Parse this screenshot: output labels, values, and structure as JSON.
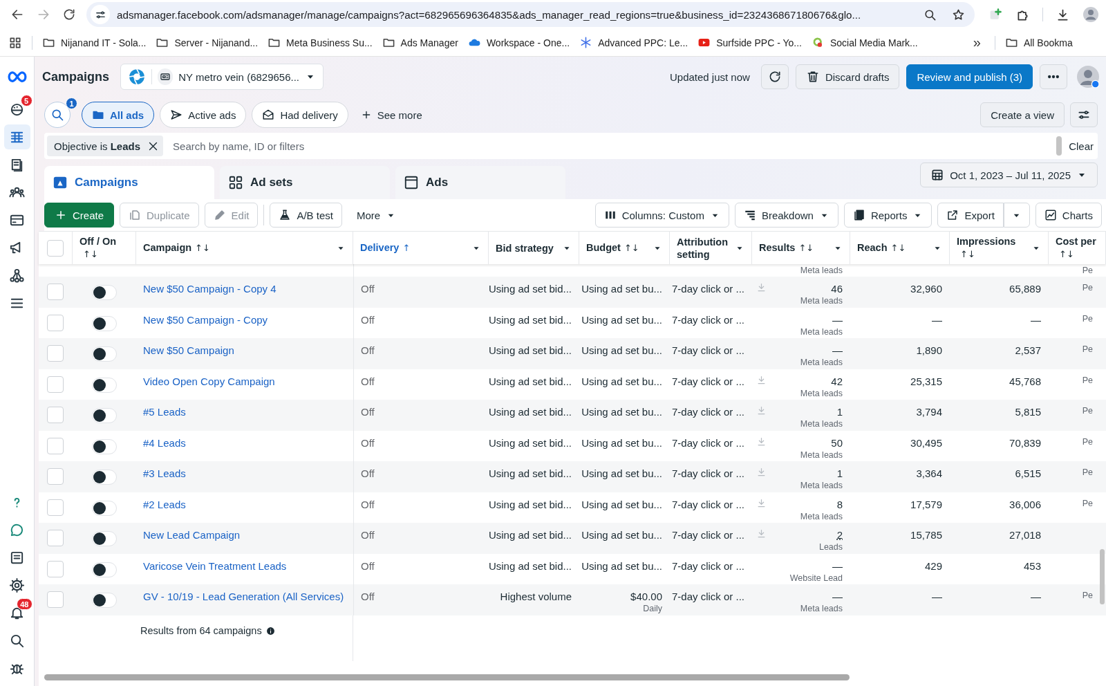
{
  "browser": {
    "url": "adsmanager.facebook.com/adsmanager/manage/campaigns?act=682965696364835&ads_manager_read_regions=true&business_id=232436867180676&glo...",
    "bookmarks": [
      {
        "kind": "folder",
        "label": "Nijanand IT - Sola..."
      },
      {
        "kind": "folder",
        "label": "Server - Nijanand..."
      },
      {
        "kind": "folder",
        "label": "Meta Business Su..."
      },
      {
        "kind": "folder",
        "label": "Ads Manager"
      },
      {
        "kind": "cloud",
        "label": "Workspace - One..."
      },
      {
        "kind": "asterisk",
        "label": "Advanced PPC: Le..."
      },
      {
        "kind": "play",
        "label": "Surfside PPC - Yo..."
      },
      {
        "kind": "gear",
        "label": "Social Media Mark..."
      }
    ],
    "overflow": "»",
    "all_bookmarks": "All Bookma"
  },
  "rail": {
    "top": [
      {
        "kind": "gauge",
        "selected": false,
        "badge": "5"
      },
      {
        "kind": "table",
        "selected": true
      },
      {
        "kind": "pages",
        "selected": false
      },
      {
        "kind": "people",
        "selected": false
      },
      {
        "kind": "card",
        "selected": false
      },
      {
        "kind": "megaphone",
        "selected": false
      },
      {
        "kind": "network",
        "selected": false
      },
      {
        "kind": "menu",
        "selected": false
      }
    ],
    "bottom": [
      {
        "kind": "question",
        "selected": false
      },
      {
        "kind": "chat",
        "selected": false
      },
      {
        "kind": "document",
        "selected": false
      },
      {
        "kind": "gear",
        "selected": false
      },
      {
        "kind": "bell",
        "selected": false,
        "badge": "48"
      },
      {
        "kind": "search",
        "selected": false
      },
      {
        "kind": "bug",
        "selected": false
      }
    ]
  },
  "header": {
    "title": "Campaigns",
    "account": "NY metro vein (6829656...",
    "updated": "Updated just now",
    "discard": "Discard drafts",
    "publish": "Review and publish (3)"
  },
  "filters": {
    "search_badge": "1",
    "chips": [
      {
        "kind": "folder",
        "label": "All ads",
        "selected": true
      },
      {
        "kind": "send",
        "label": "Active ads",
        "selected": false
      },
      {
        "kind": "envelope",
        "label": "Had delivery",
        "selected": false
      }
    ],
    "see_more": "See more",
    "create_view": "Create a view"
  },
  "search": {
    "tag": "Objective is **Leads**",
    "placeholder": "Search by name, ID or filters",
    "clear": "Clear"
  },
  "tabs": [
    {
      "kind": "campaigns",
      "label": "Campaigns",
      "selected": true
    },
    {
      "kind": "adsets",
      "label": "Ad sets",
      "selected": false
    },
    {
      "kind": "ads",
      "label": "Ads",
      "selected": false
    }
  ],
  "date_range": "Oct 1, 2023 – Jul 11, 2025",
  "toolbar": {
    "left": [
      {
        "kind": "create",
        "label": "Create",
        "disabled": false
      },
      {
        "kind": "duplicate",
        "label": "Duplicate",
        "disabled": true
      },
      {
        "kind": "edit",
        "label": "Edit",
        "disabled": true
      },
      {
        "kind": "abtest",
        "label": "A/B test",
        "disabled": false
      },
      {
        "kind": "more",
        "label": "More",
        "disabled": false
      }
    ],
    "right": [
      {
        "kind": "columns",
        "label": "Columns: Custom"
      },
      {
        "kind": "breakdown",
        "label": "Breakdown"
      },
      {
        "kind": "reports",
        "label": "Reports"
      },
      {
        "kind": "export",
        "label": "Export"
      },
      {
        "kind": "charts",
        "label": "Charts"
      }
    ]
  },
  "table": {
    "columns": [
      {
        "kind": "check",
        "checked": false
      },
      {
        "kind": "text",
        "label": "Off / On",
        "sort": "↑↓",
        "sorted": false
      },
      {
        "kind": "menu",
        "label": "Campaign",
        "sort": "↑↓",
        "sorted": false
      },
      {
        "kind": "menu",
        "label": "Delivery",
        "sort": "↑",
        "sorted": true
      },
      {
        "kind": "menu",
        "label": "Bid strategy",
        "sorted": false
      },
      {
        "kind": "menu",
        "label": "Budget",
        "sort": "↑↓",
        "sorted": false
      },
      {
        "kind": "menu",
        "label": "Attribution setting",
        "sorted": false
      },
      {
        "kind": "menu",
        "label": "Results",
        "sort": "↑↓",
        "sorted": false
      },
      {
        "kind": "menu",
        "label": "Reach",
        "sort": "↑↓",
        "sorted": false
      },
      {
        "kind": "menu",
        "label": "Impressions",
        "sort": "↑↓",
        "sorted": false
      },
      {
        "kind": "text",
        "label": "Cost per",
        "sort": "↑↓",
        "sorted": false
      }
    ],
    "partial_row": {
      "results_type": "Meta leads",
      "cost": "Pe"
    },
    "rows": [
      {
        "checked": false,
        "on": false,
        "name": "New $50 Campaign - Copy 4",
        "delivery": "Off",
        "bid": "Using ad set bid...",
        "budget": "Using ad set bu...",
        "attribution": "7-day click or ...",
        "downloadable": true,
        "results": "46",
        "underlined": false,
        "results_type": "Meta leads",
        "reach": "32,960",
        "impressions": "65,889",
        "cost": "Pe"
      },
      {
        "checked": false,
        "on": false,
        "name": "New $50 Campaign - Copy",
        "delivery": "Off",
        "bid": "Using ad set bid...",
        "budget": "Using ad set bu...",
        "attribution": "7-day click or ...",
        "downloadable": false,
        "results": "—",
        "underlined": false,
        "results_type": "Meta leads",
        "reach": "—",
        "impressions": "—",
        "cost": "Pe"
      },
      {
        "checked": false,
        "on": false,
        "name": "New $50 Campaign",
        "delivery": "Off",
        "bid": "Using ad set bid...",
        "budget": "Using ad set bu...",
        "attribution": "7-day click or ...",
        "downloadable": false,
        "results": "—",
        "underlined": false,
        "results_type": "Meta leads",
        "reach": "1,890",
        "impressions": "2,537",
        "cost": "Pe"
      },
      {
        "checked": false,
        "on": false,
        "name": "Video Open Copy Campaign",
        "delivery": "Off",
        "bid": "Using ad set bid...",
        "budget": "Using ad set bu...",
        "attribution": "7-day click or ...",
        "downloadable": true,
        "results": "42",
        "underlined": false,
        "results_type": "Meta leads",
        "reach": "25,315",
        "impressions": "45,768",
        "cost": "Pe"
      },
      {
        "checked": false,
        "on": false,
        "name": "#5 Leads",
        "delivery": "Off",
        "bid": "Using ad set bid...",
        "budget": "Using ad set bu...",
        "attribution": "7-day click or ...",
        "downloadable": true,
        "results": "1",
        "underlined": false,
        "results_type": "Meta leads",
        "reach": "3,794",
        "impressions": "5,815",
        "cost": "Pe"
      },
      {
        "checked": false,
        "on": false,
        "name": "#4 Leads",
        "delivery": "Off",
        "bid": "Using ad set bid...",
        "budget": "Using ad set bu...",
        "attribution": "7-day click or ...",
        "downloadable": true,
        "results": "50",
        "underlined": false,
        "results_type": "Meta leads",
        "reach": "30,495",
        "impressions": "70,839",
        "cost": "Pe"
      },
      {
        "checked": false,
        "on": false,
        "name": "#3 Leads",
        "delivery": "Off",
        "bid": "Using ad set bid...",
        "budget": "Using ad set bu...",
        "attribution": "7-day click or ...",
        "downloadable": true,
        "results": "1",
        "underlined": false,
        "results_type": "Meta leads",
        "reach": "3,364",
        "impressions": "6,515",
        "cost": "Pe"
      },
      {
        "checked": false,
        "on": false,
        "name": "#2 Leads",
        "delivery": "Off",
        "bid": "Using ad set bid...",
        "budget": "Using ad set bu...",
        "attribution": "7-day click or ...",
        "downloadable": true,
        "results": "8",
        "underlined": false,
        "results_type": "Meta leads",
        "reach": "17,579",
        "impressions": "36,006",
        "cost": "Pe"
      },
      {
        "checked": false,
        "on": false,
        "name": "New Lead Campaign",
        "delivery": "Off",
        "bid": "Using ad set bid...",
        "budget": "Using ad set bu...",
        "attribution": "7-day click or ...",
        "downloadable": true,
        "results": "2",
        "underlined": true,
        "results_type": "Leads",
        "reach": "15,785",
        "impressions": "27,018"
      },
      {
        "checked": false,
        "on": false,
        "name": "Varicose Vein Treatment Leads",
        "delivery": "Off",
        "bid": "Using ad set bid...",
        "budget": "Using ad set bu...",
        "attribution": "7-day click or ...",
        "downloadable": false,
        "results": "—",
        "underlined": false,
        "results_type": "Website Lead",
        "reach": "429",
        "impressions": "453"
      },
      {
        "checked": false,
        "on": false,
        "name": "GV - 10/19 - Lead Generation (All Services)",
        "delivery": "Off",
        "bid": "Highest volume",
        "budget": "$40.00",
        "budget_period": "Daily",
        "attribution": "7-day click or ...",
        "downloadable": false,
        "results": "—",
        "underlined": false,
        "results_type": "Meta leads",
        "reach": "—",
        "impressions": "—",
        "cost": "Pe"
      }
    ],
    "footer": "Results from 64 campaigns"
  }
}
